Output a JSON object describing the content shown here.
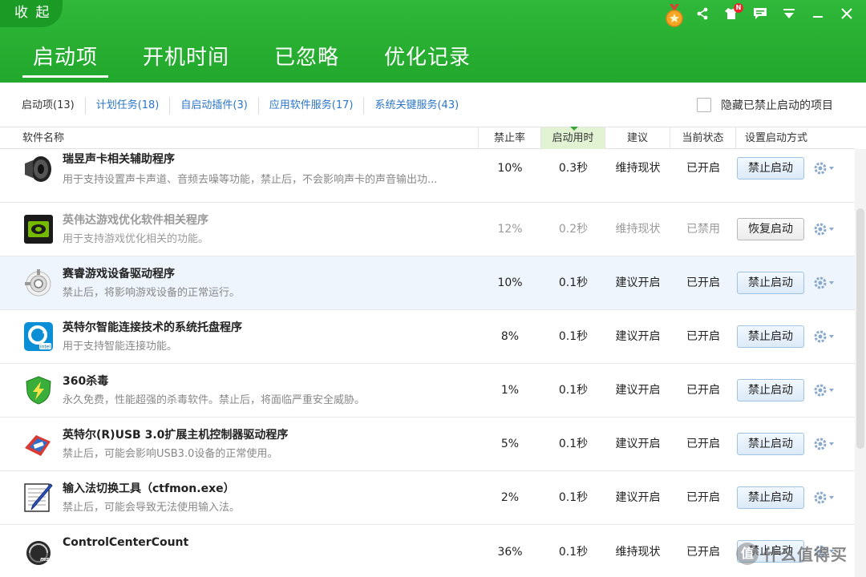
{
  "header": {
    "collapse_label": "收 起",
    "tabs": [
      {
        "label": "启动项"
      },
      {
        "label": "开机时间"
      },
      {
        "label": "已忽略"
      },
      {
        "label": "优化记录"
      }
    ],
    "notification_badge": "N"
  },
  "subtabs": [
    {
      "label": "启动项(13)"
    },
    {
      "label": "计划任务(18)"
    },
    {
      "label": "自启动插件(3)"
    },
    {
      "label": "应用软件服务(17)"
    },
    {
      "label": "系统关键服务(43)"
    }
  ],
  "hide_disabled_label": "隐藏已禁止启动的项目",
  "columns": {
    "name": "软件名称",
    "rate": "禁止率",
    "time": "启动用时",
    "suggestion": "建议",
    "state": "当前状态",
    "mode": "设置启动方式"
  },
  "rows": [
    {
      "title": "瑞昱声卡相关辅助程序",
      "desc": "用于支持设置声卡声道、音频去噪等功能，禁止后，不会影响声卡的声音输出功...",
      "rate": "10%",
      "time": "0.3秒",
      "suggestion": "维持现状",
      "state": "已开启",
      "action": "禁止启动",
      "icon": "speaker-icon"
    },
    {
      "title": "英伟达游戏优化软件相关程序",
      "desc": "用于支持游戏优化相关的功能。",
      "rate": "12%",
      "time": "0.2秒",
      "suggestion": "维持现状",
      "state": "已禁用",
      "action": "恢复启动",
      "icon": "nvidia-icon"
    },
    {
      "title": "赛睿游戏设备驱动程序",
      "desc": "禁止后，将影响游戏设备的正常运行。",
      "rate": "10%",
      "time": "0.1秒",
      "suggestion": "建议开启",
      "state": "已开启",
      "action": "禁止启动",
      "icon": "steelseries-icon"
    },
    {
      "title": "英特尔智能连接技术的系统托盘程序",
      "desc": "用于支持智能连接功能。",
      "rate": "8%",
      "time": "0.1秒",
      "suggestion": "建议开启",
      "state": "已开启",
      "action": "禁止启动",
      "icon": "intel-connect-icon"
    },
    {
      "title": "360杀毒",
      "desc": "永久免费，性能超强的杀毒软件。禁止后，将面临严重安全威胁。",
      "rate": "1%",
      "time": "0.1秒",
      "suggestion": "建议开启",
      "state": "已开启",
      "action": "禁止启动",
      "icon": "shield-icon"
    },
    {
      "title": "英特尔(R)USB 3.0扩展主机控制器驱动程序",
      "desc": "禁止后，可能会影响USB3.0设备的正常使用。",
      "rate": "5%",
      "time": "0.1秒",
      "suggestion": "建议开启",
      "state": "已开启",
      "action": "禁止启动",
      "icon": "usb-icon"
    },
    {
      "title": "输入法切换工具（ctfmon.exe）",
      "desc": "禁止后，可能会导致无法使用输入法。",
      "rate": "2%",
      "time": "0.1秒",
      "suggestion": "建议开启",
      "state": "已开启",
      "action": "禁止启动",
      "icon": "pen-icon"
    },
    {
      "title": "ControlCenterCount",
      "desc": "",
      "rate": "36%",
      "time": "0.1秒",
      "suggestion": "维持现状",
      "state": "已开启",
      "action": "禁止启动",
      "icon": "msi-icon"
    }
  ],
  "watermark": {
    "glyph": "值",
    "text": "什么值得买"
  },
  "colors": {
    "header_green": "#22a82c",
    "link_blue": "#2b76c8",
    "sort_col_bg": "#e2f3d4"
  }
}
